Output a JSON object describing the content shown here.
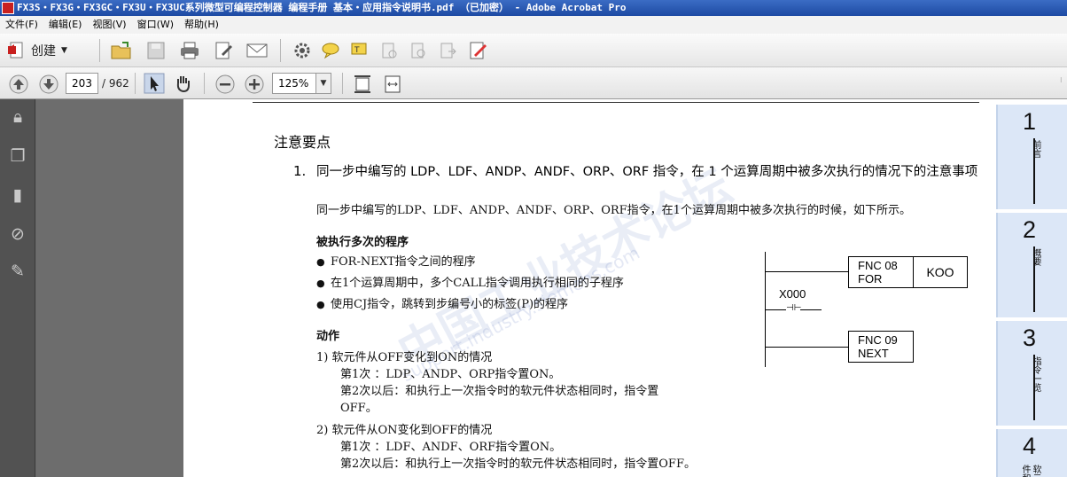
{
  "window": {
    "title": "FX3S・FX3G・FX3GC・FX3U・FX3UC系列微型可编程控制器 编程手册 基本・应用指令说明书.pdf （已加密） - Adobe Acrobat Pro"
  },
  "menu": [
    "文件(F)",
    "编辑(E)",
    "视图(V)",
    "窗口(W)",
    "帮助(H)"
  ],
  "toolbar": {
    "create_label": "创建",
    "page_current": "203",
    "page_total": "/ 962",
    "zoom": "125%"
  },
  "document": {
    "heading": "注意要点",
    "item_number": "1.",
    "item_title": "同一步中编写的 LDP、LDF、ANDP、ANDF、ORP、ORF 指令，在 1 个运算周期中被多次执行的情况下的注意事项",
    "item_desc": "同一步中编写的LDP、LDF、ANDP、ANDF、ORP、ORF指令，在1个运算周期中被多次执行的时候，如下所示。",
    "sub1_title": "被执行多次的程序",
    "bullets": [
      "FOR-NEXT指令之间的程序",
      "在1个运算周期中，多个CALL指令调用执行相同的子程序",
      "使用CJ指令，跳转到步编号小的标签(P)的程序"
    ],
    "sub2_title": "动作",
    "action1_title": "1)   软元件从OFF变化到ON的情况",
    "action1_line1": "第1次      ：LDP、ANDP、ORP指令置ON。",
    "action1_line2": "第2次以后：和执行上一次指令时的软元件状态相同时，指令置",
    "action1_line3": "OFF。",
    "action2_title": "2)   软元件从ON变化到OFF的情况",
    "action2_line1": "第1次      ：LDF、ANDF、ORF指令置ON。",
    "action2_line2": "第2次以后：和执行上一次指令时的软元件状态相同时，指令置OFF。"
  },
  "ladder": {
    "fnc08": [
      "FNC 08",
      "FOR"
    ],
    "koo": "KOO",
    "contact": "X000",
    "fnc09": [
      "FNC 09",
      "NEXT"
    ]
  },
  "tabs": [
    {
      "num": "1",
      "label": "前言"
    },
    {
      "num": "2",
      "label": "概要"
    },
    {
      "num": "3",
      "label": "指令一览"
    },
    {
      "num": "4",
      "label": "软元件和"
    }
  ],
  "watermark": {
    "main": "中国工业技术论坛",
    "sub": "support.industry.siemens.com"
  }
}
